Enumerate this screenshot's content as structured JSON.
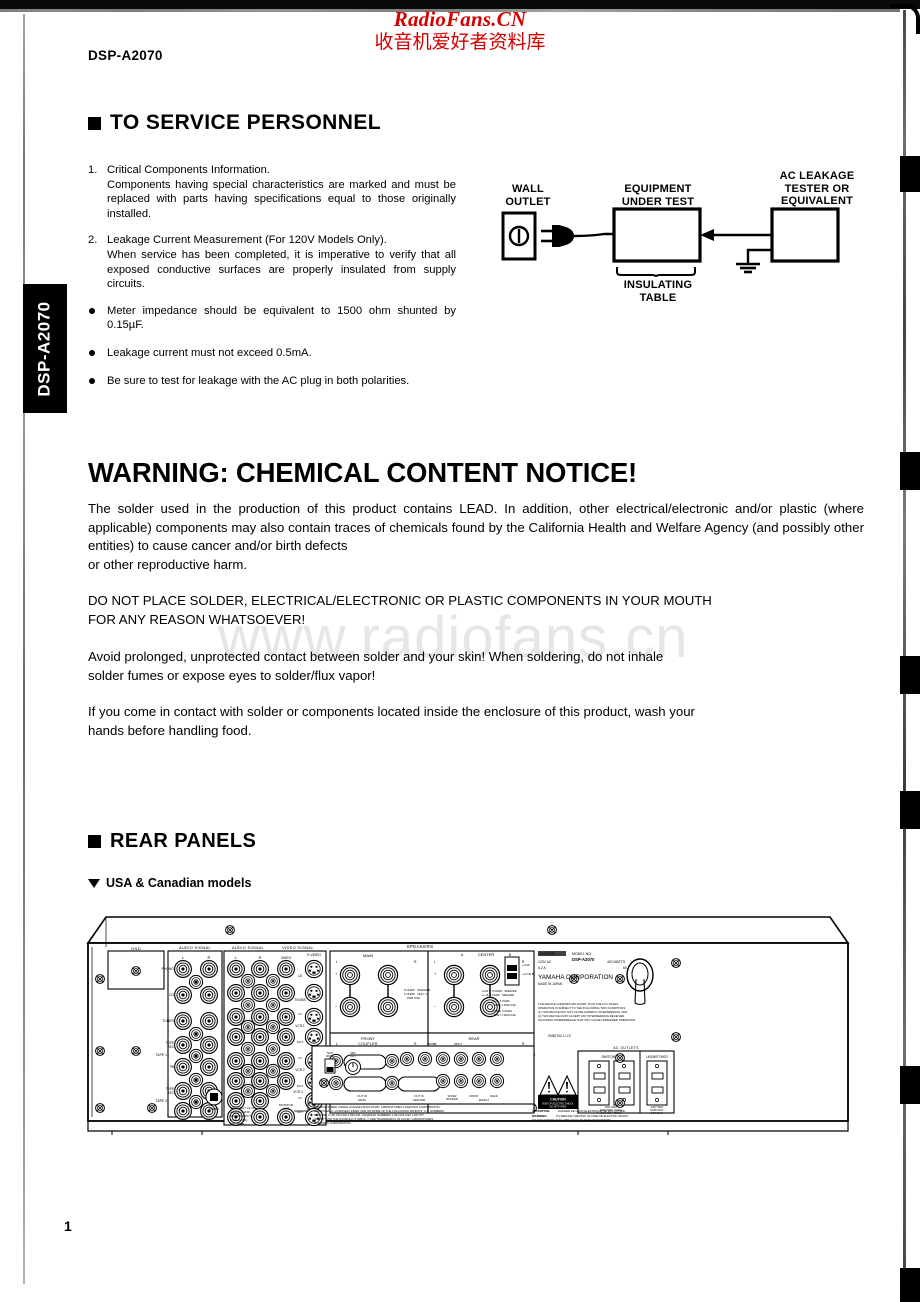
{
  "watermark": {
    "english": "RadioFans.CN",
    "chinese": "收音机爱好者资料库",
    "center": "www.radiofans.cn",
    "color": "#d40000"
  },
  "header": {
    "model": "DSP-A2070"
  },
  "side_tab": {
    "label": "DSP-A2070"
  },
  "page_number": "1",
  "sections": {
    "service": {
      "heading": "TO SERVICE PERSONNEL",
      "numbered": [
        {
          "marker": "1.",
          "first_line": "Critical Components Information.",
          "rest": "Components having special characteristics are marked and must be replaced with parts having specifications equal to those originally installed."
        },
        {
          "marker": "2.",
          "first_line": "Leakage Current Measurement (For 120V Models Only).",
          "rest": "When service has been completed, it is imperative to verify that all exposed conductive surfaces are properly insulated from supply circuits."
        }
      ],
      "bullets": [
        "Meter impedance should be equivalent to 1500 ohm shunted by 0.15µF.",
        "Leakage current must not exceed 0.5mA.",
        "Be sure to test for leakage with the AC plug in both polarities."
      ]
    },
    "leakage_diagram": {
      "wall_outlet": "WALL\nOUTLET",
      "wall_outlet_l1": "WALL",
      "wall_outlet_l2": "OUTLET",
      "equipment_l1": "EQUIPMENT",
      "equipment_l2": "UNDER TEST",
      "tester_l1": "AC LEAKAGE",
      "tester_l2": "TESTER OR",
      "tester_l3": "EQUIVALENT",
      "table_l1": "INSULATING",
      "table_l2": "TABLE"
    },
    "warning": {
      "title": "WARNING: CHEMICAL CONTENT NOTICE!",
      "paragraph_1": "The solder used in the production of this product contains LEAD. In addition, other electrical/electronic and/or plastic (where applicable) components may also contain traces of chemicals found by the California Health and Welfare Agency (and possibly other entities) to cause cancer and/or birth defects",
      "paragraph_1_last": "or other reproductive harm.",
      "paragraph_2": "DO NOT PLACE SOLDER, ELECTRICAL/ELECTRONIC OR PLASTIC COMPONENTS IN YOUR MOUTH",
      "paragraph_2_last": "FOR ANY REASON WHATSOEVER!",
      "paragraph_3": "Avoid prolonged, unprotected contact between solder and your skin! When soldering, do not inhale",
      "paragraph_3_last": "solder fumes or expose eyes to solder/flux vapor!",
      "paragraph_4": "If you come in contact with solder or components located inside the enclosure of this product, wash your",
      "paragraph_4_last": "hands before handling food."
    },
    "rear_panels": {
      "heading": "REAR PANELS",
      "subheading": "USA & Canadian models",
      "panel_labels": {
        "gnd": "GND",
        "audio_signal_1": "AUDIO SIGNAL",
        "audio_signal_2": "AUDIO SIGNAL",
        "video_signal": "VIDEO SIGNAL",
        "video": "VIDEO",
        "s_video": "S VIDEO",
        "speakers": "SPEAKERS",
        "main": "MAIN",
        "center": "CENTER",
        "front": "FRONT",
        "rear": "REAR",
        "coupler": "COUPLER",
        "ac_outlets": "AC OUTLETS",
        "switched": "SWITCHED",
        "unswitched": "UNSWITCHED",
        "caution": "CAUTION",
        "monitor_out": "MONITOR OUT",
        "impedance_selector": "IMPEDANCE SELECTOR"
      },
      "input_rows": [
        "PHONO",
        "CD",
        "TUNER",
        "TAPE 1",
        "TAPE 2"
      ],
      "video_rows": [
        "LD",
        "TV/DBS",
        "VCR 1",
        "VCR 2",
        "VCR 3"
      ],
      "nameplate": {
        "voltage_label": "VOLTAGE",
        "model_label": "MODEL NO.",
        "model": "DSP-A2070",
        "voltage": "120V AC",
        "power": "400 WATTS",
        "current": "6.2 A",
        "frequency": "60 Hz",
        "company": "YAMAHA CORPORATION",
        "origin": "MADE IN JAPAN",
        "fcc_line_1": "THIS DEVICE COMPLIES WITH PART 15 OF THE FCC RULES.",
        "fcc_line_2": "OPERATION IS SUBJECT TO THE FOLLOWING TWO CONDITIONS:",
        "fcc_line_3": "(1) THIS DEVICE MAY NOT CAUSE HARMFUL INTERFERENCE, AND",
        "fcc_line_4": "(2) THIS DEVICE MUST ACCEPT ANY INTERFERENCE RECEIVED,",
        "fcc_line_5": "INCLUDING INTERFERENCE THAT MAY CAUSE UNDESIRED OPERATION.",
        "code": "VM82760-1   U.S"
      },
      "outlet_ratings": {
        "switched": "120V 60Hz\n100W MAX. TOTAL\n1.0A MAX. TOTAL",
        "unswitched": "120V 60Hz\n100W MAX.\n1.0A MAX."
      },
      "dolby_notice": "MANUFACTURED UNDER LICENSE FROM DOLBY LABORATORIES LICENSING CORPORATION. ADDITIONALLY LICENSED UNDER ONE OR MORE OF THE FOLLOWING PATENTS: U.S. NUMBERS 3,632,886, 3,746,799 AND 3,995,284; CANADIAN NUMBERS 1,004,603 AND 1,037,877. \"DOLBY\" AND THE DOUBLE-D SYMBOL Ⓓ ARE TRADEMARKS OF DOLBY LABORATORIES LICENSING CORPORATION.",
      "warning_text": "WARNING: TO REDUCE THE RISK OF FIRE OR ELECTRIC SHOCK, DO NOT EXPOSE THIS APPLIANCE TO RAIN OR MOISTURE.",
      "attention_text": "ATTENTION: DANGER DE CHOC ELECTRIQUE NE PAS OUVRIR.",
      "vcr_note": "VCR 3 OUT can be used as a 2ND MONITOR OUT, if selected by SET MENU."
    }
  }
}
